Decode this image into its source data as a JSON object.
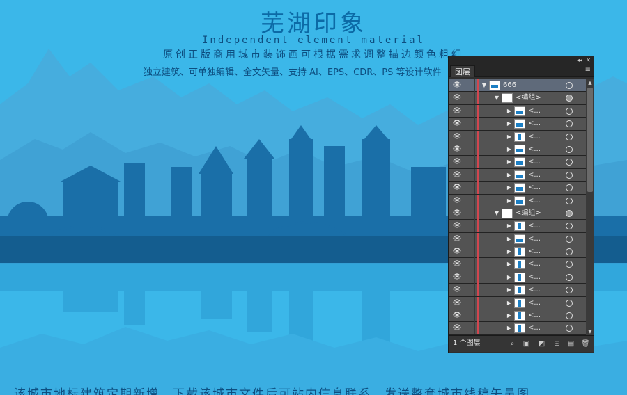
{
  "poster": {
    "title": "芜湖印象",
    "subtitle": "Independent element material",
    "line": "原创正版商用城市装饰画可根据需求调整描边颜色粗细",
    "box_text": "独立建筑、可单独编辑、全文矢量、支持 AI、EPS、CDR、PS 等设计软件",
    "footer": "该城市地标建筑定期新增，下载该城市文件后可站内信息联系，发送整套城市线稿矢量图"
  },
  "colors": {
    "sky": "#3bb7e9",
    "mountain_far": "#4aa8d6",
    "city_dark": "#145d8f",
    "city_mid": "#1a74ad",
    "water": "#3aaee2",
    "panel_bg": "#535353",
    "accent_red": "#d1464f"
  },
  "panel": {
    "tab_label": "图层",
    "collapse_icon": "double-chevron-icon",
    "close_icon": "close-icon",
    "menu_icon": "panel-menu-icon",
    "layer_count": "1 个图层",
    "bottom_buttons": [
      "search-icon",
      "collect-export-icon",
      "make-clip-mask-icon",
      "new-sublayer-icon",
      "new-layer-icon",
      "delete-icon"
    ],
    "rows": [
      {
        "name": "666",
        "level": 0,
        "expanded": true,
        "top": true,
        "target_filled": false,
        "thumb": "h"
      },
      {
        "name": "<编组>",
        "level": 1,
        "expanded": true,
        "target_filled": true,
        "thumb": "blank"
      },
      {
        "name": "<...",
        "level": 2,
        "expanded": false,
        "target_filled": false,
        "thumb": "h"
      },
      {
        "name": "<...",
        "level": 2,
        "expanded": false,
        "target_filled": false,
        "thumb": "h"
      },
      {
        "name": "<...",
        "level": 2,
        "expanded": false,
        "target_filled": false,
        "thumb": "v"
      },
      {
        "name": "<...",
        "level": 2,
        "expanded": false,
        "target_filled": false,
        "thumb": "h"
      },
      {
        "name": "<...",
        "level": 2,
        "expanded": false,
        "target_filled": false,
        "thumb": "h"
      },
      {
        "name": "<...",
        "level": 2,
        "expanded": false,
        "target_filled": false,
        "thumb": "h"
      },
      {
        "name": "<...",
        "level": 2,
        "expanded": false,
        "target_filled": false,
        "thumb": "h"
      },
      {
        "name": "<...",
        "level": 2,
        "expanded": false,
        "target_filled": false,
        "thumb": "h"
      },
      {
        "name": "<编组>",
        "level": 1,
        "expanded": true,
        "target_filled": true,
        "thumb": "blank"
      },
      {
        "name": "<...",
        "level": 2,
        "expanded": false,
        "target_filled": false,
        "thumb": "v"
      },
      {
        "name": "<...",
        "level": 2,
        "expanded": false,
        "target_filled": false,
        "thumb": "h"
      },
      {
        "name": "<...",
        "level": 2,
        "expanded": false,
        "target_filled": false,
        "thumb": "v"
      },
      {
        "name": "<...",
        "level": 2,
        "expanded": false,
        "target_filled": false,
        "thumb": "v"
      },
      {
        "name": "<...",
        "level": 2,
        "expanded": false,
        "target_filled": false,
        "thumb": "v"
      },
      {
        "name": "<...",
        "level": 2,
        "expanded": false,
        "target_filled": false,
        "thumb": "v"
      },
      {
        "name": "<...",
        "level": 2,
        "expanded": false,
        "target_filled": false,
        "thumb": "v"
      },
      {
        "name": "<...",
        "level": 2,
        "expanded": false,
        "target_filled": false,
        "thumb": "v"
      },
      {
        "name": "<...",
        "level": 2,
        "expanded": false,
        "target_filled": false,
        "thumb": "v"
      }
    ]
  }
}
